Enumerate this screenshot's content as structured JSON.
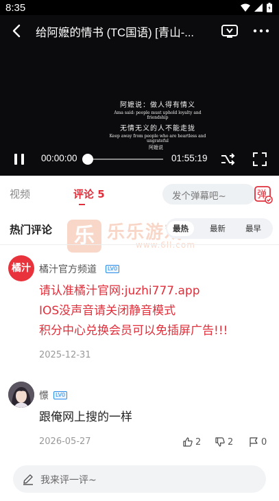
{
  "status_bar": {
    "time": "8:35"
  },
  "player": {
    "title": "给阿嬷的情书 (TC国语) [青山-...",
    "subtitle_lines": [
      "阿嬷说：做人得有情义",
      "Ama said: people must uphold loyalty and friendship",
      "无情无义的人不能走拢",
      "Keep away from people who are heartless and ungrateful"
    ],
    "chapter_mark": "阿嬷说",
    "current_time": "00:00:00",
    "total_time": "01:55:19",
    "progress": 0
  },
  "tabs": {
    "video_label": "视频",
    "comments_label": "评论 5",
    "danmaku_placeholder": "发个弹幕吧~",
    "danmaku_btn_glyph": "弹"
  },
  "hot": {
    "title": "热门评论",
    "sort": [
      "最热",
      "最新",
      "最早"
    ]
  },
  "watermark": {
    "logo": "乐",
    "name": "乐乐游戏",
    "url": "www.6ll.com"
  },
  "comments": [
    {
      "avatar_text": "橘汁",
      "name": "橘汁官方频道",
      "level": "LV0",
      "lines": [
        "请认准橘汁官网:juzhi777.app",
        "IOS没声音请关闭静音模式",
        "积分中心兑换会员可以免插屏广告!!!"
      ],
      "date": "2025-12-31"
    },
    {
      "name": "憬",
      "level": "LV0",
      "lines": [
        "跟俺网上搜的一样"
      ],
      "date": "2026-05-27",
      "likes": "2",
      "dislikes": "2",
      "reports": "0"
    }
  ],
  "bottom": {
    "placeholder": "我来评一评~"
  },
  "colors": {
    "accent": "#e02e3a",
    "level": "#2a8be8"
  }
}
